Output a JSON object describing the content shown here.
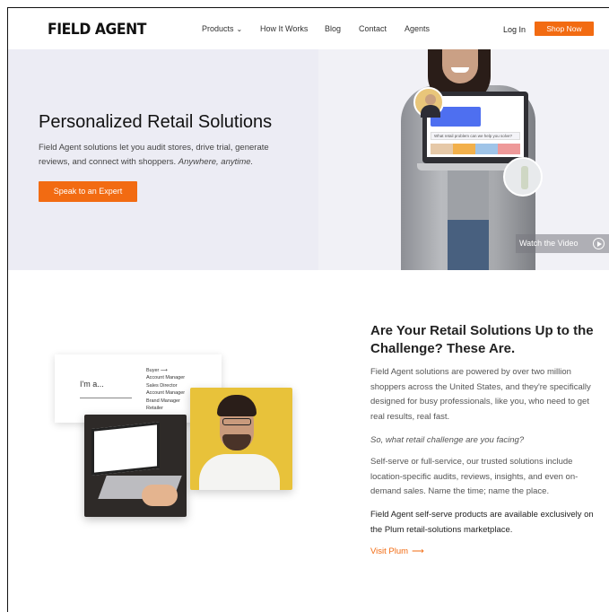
{
  "header": {
    "logo": "FIELD AGENT",
    "nav": {
      "products": "Products",
      "how_it_works": "How It Works",
      "blog": "Blog",
      "contact": "Contact",
      "agents": "Agents"
    },
    "login": "Log In",
    "shop_now": "Shop Now"
  },
  "hero": {
    "title": "Personalized Retail Solutions",
    "description": "Field Agent solutions let you audit stores, drive trial, generate reviews, and connect with shoppers.",
    "description_em": "Anywhere, anytime.",
    "cta": "Speak to an Expert",
    "watch_video": "Watch the Video",
    "screen_search": "What retail problem can we help you solve?"
  },
  "section2": {
    "title": "Are Your Retail Solutions Up to the Challenge? These Are.",
    "p1": "Field Agent solutions are powered by over two million shoppers across the United States, and they're specifically designed for busy professionals, like you, who need to get real results, real fast.",
    "p2": "So, what retail challenge are you facing?",
    "p3": "Self-serve or full-service, our trusted solutions include location-specific audits, reviews, insights, and even on-demand sales. Name the time; name the place.",
    "p4": "Field Agent self-serve products are available exclusively on the Plum retail-solutions marketplace.",
    "visit": "Visit Plum",
    "visit_arrow": "⟶"
  },
  "collage": {
    "iam_label": "I'm a...",
    "options": [
      "Buyer ⟶",
      "Account Manager",
      "Sales Director",
      "Account Manager",
      "Brand Manager",
      "Retailer"
    ]
  },
  "colors": {
    "accent": "#f26b12",
    "hero_bg": "#ececf4"
  }
}
